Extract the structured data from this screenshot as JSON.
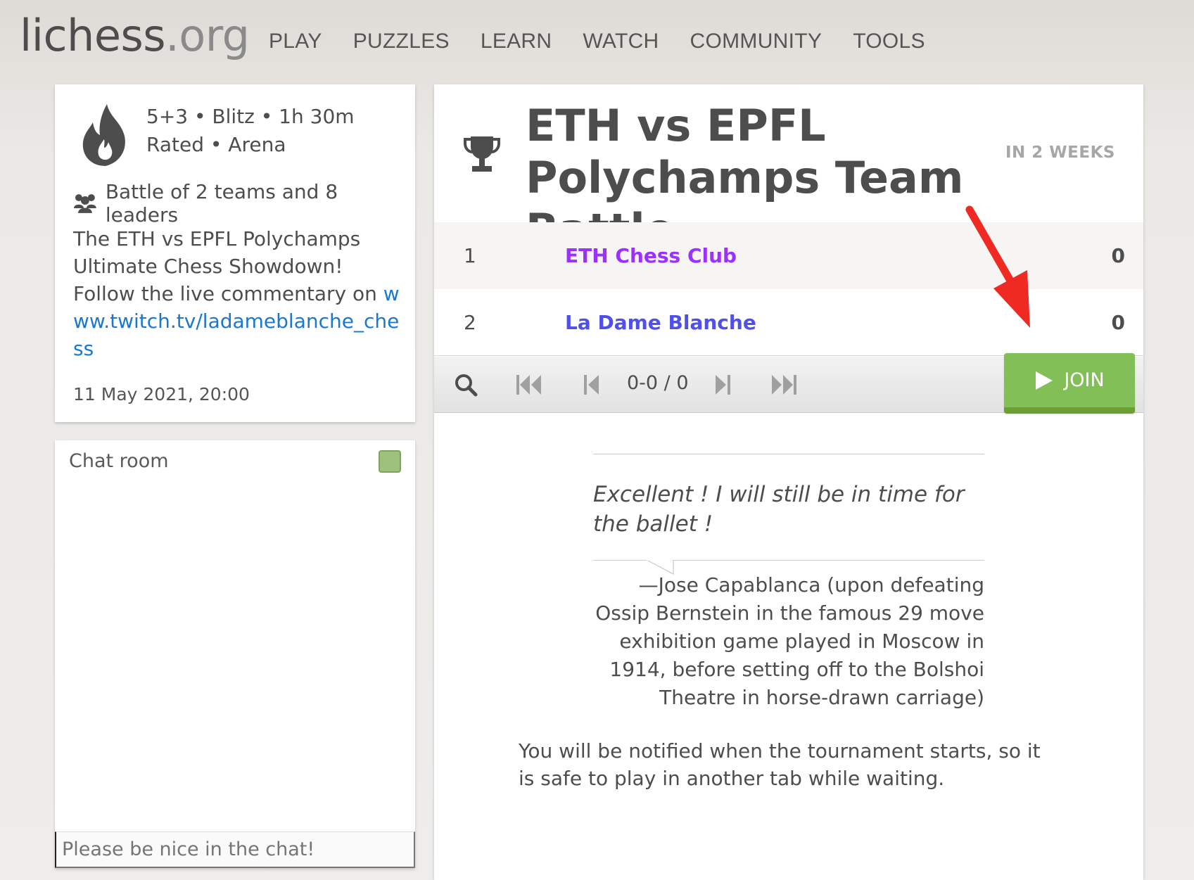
{
  "header": {
    "logo_main": "lichess",
    "logo_tld": ".org",
    "nav": [
      "PLAY",
      "PUZZLES",
      "LEARN",
      "WATCH",
      "COMMUNITY",
      "TOOLS"
    ]
  },
  "info": {
    "setup_line1": "5+3 • Blitz • 1h 30m",
    "setup_line2": "Rated • Arena",
    "teams_line": "Battle of 2 teams and 8 leaders",
    "description": "The ETH vs EPFL Polychamps Ultimate Chess Showdown! Follow the live commentary on",
    "link": "www.twitch.tv/ladameblanche_chess",
    "date": "11 May 2021, 20:00"
  },
  "chat": {
    "title": "Chat room",
    "placeholder": "Please be nice in the chat!"
  },
  "tournament": {
    "title": "ETH vs EPFL Polychamps Team Battle",
    "starts": "IN 2 WEEKS",
    "standings": [
      {
        "rank": "1",
        "team": "ETH Chess Club",
        "score": "0"
      },
      {
        "rank": "2",
        "team": "La Dame Blanche",
        "score": "0"
      }
    ],
    "counter": "0-0 / 0",
    "join_label": "JOIN"
  },
  "quote": {
    "text": "Excellent ! I will still be in time for the ballet !",
    "author": "—Jose Capablanca (upon defeating Ossip Bernstein in the famous 29 move exhibition game played in Moscow in 1914, before setting off to the Bolshoi Theatre in horse-drawn carriage)"
  },
  "notice": "You will be notified when the tournament starts, so it is safe to play in another tab while waiting.",
  "colors": {
    "team1": "#9b30ff",
    "team2": "#5050e8",
    "join_button": "#82bf56",
    "link": "#1b78d0",
    "annotation_arrow": "#ee2a23"
  }
}
